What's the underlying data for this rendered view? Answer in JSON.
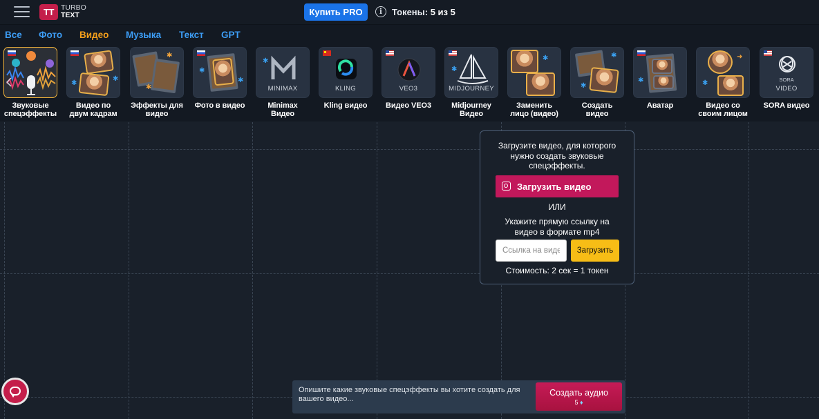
{
  "header": {
    "logo_mark": "TT",
    "logo_line1": "TURBO",
    "logo_line2": "TEXT",
    "buy_pro_label": "Купить PRO",
    "tokens_label": "Токены:",
    "tokens_value": "5 из 5"
  },
  "categories": [
    {
      "label": "Все",
      "active": false
    },
    {
      "label": "Фото",
      "active": false
    },
    {
      "label": "Видео",
      "active": true
    },
    {
      "label": "Музыка",
      "active": false
    },
    {
      "label": "Текст",
      "active": false
    },
    {
      "label": "GPT",
      "active": false
    }
  ],
  "tools": [
    {
      "line1": "Звуковые",
      "line2": "спецэффекты",
      "flag": "ru",
      "icon": "sound-effects-icon",
      "active": true
    },
    {
      "line1": "Видео по",
      "line2": "двум кадрам",
      "flag": "ru",
      "icon": "two-frames-icon",
      "active": false
    },
    {
      "line1": "Эффекты для",
      "line2": "видео",
      "flag": "",
      "icon": "video-effects-icon",
      "active": false
    },
    {
      "line1": "Фото в видео",
      "line2": "",
      "flag": "ru",
      "icon": "photo-to-video-icon",
      "active": false
    },
    {
      "line1": "Minimax",
      "line2": "Видео",
      "flag": "",
      "icon": "minimax-logo-icon",
      "brand": "MINIMAX",
      "active": false
    },
    {
      "line1": "Kling видео",
      "line2": "",
      "flag": "cn",
      "icon": "kling-logo-icon",
      "brand": "KLING",
      "active": false
    },
    {
      "line1": "Видео VEO3",
      "line2": "",
      "flag": "us",
      "icon": "veo3-logo-icon",
      "brand": "VEO3",
      "active": false
    },
    {
      "line1": "Midjourney",
      "line2": "Видео",
      "flag": "us",
      "icon": "midjourney-logo-icon",
      "brand": "MIDJOURNEY",
      "active": false
    },
    {
      "line1": "Заменить",
      "line2": "лицо (видео)",
      "flag": "",
      "icon": "face-swap-icon",
      "active": false
    },
    {
      "line1": "Создать",
      "line2": "видео",
      "flag": "",
      "icon": "create-video-icon",
      "active": false
    },
    {
      "line1": "Аватар",
      "line2": "",
      "flag": "ru",
      "icon": "avatar-icon",
      "active": false
    },
    {
      "line1": "Видео со",
      "line2": "своим лицом",
      "flag": "",
      "icon": "own-face-video-icon",
      "active": false
    },
    {
      "line1": "SORA видео",
      "line2": "",
      "flag": "",
      "icon": "sora-logo-icon",
      "brand": "SORA",
      "brand2": "VIDEO",
      "active": false
    }
  ],
  "upload_panel": {
    "hint_line1": "Загрузите видео, для которого",
    "hint_line2": "нужно создать звуковые",
    "hint_line3": "спецэффекты.",
    "upload_button": "Загрузить видео",
    "or_label": "ИЛИ",
    "url_hint_line1": "Укажите прямую ссылку на",
    "url_hint_line2": "видео в формате mp4",
    "url_placeholder": "Ссылка на видео",
    "load_button": "Загрузить",
    "cost": "Стоимость: 2 сек = 1 токен"
  },
  "prompt_bar": {
    "placeholder_line1": "Опишите какие звуковые спецэффекты вы хотите создать для",
    "placeholder_line2": "вашего видео...",
    "create_button": "Создать аудио",
    "create_cost": "5",
    "cost_icon": "diamond-icon"
  },
  "colors": {
    "accent_pink": "#c2185b",
    "accent_blue": "#1a73e8",
    "active_tab": "#f59f1b",
    "tab": "#3d9df5",
    "load_button": "#f7bd16"
  }
}
